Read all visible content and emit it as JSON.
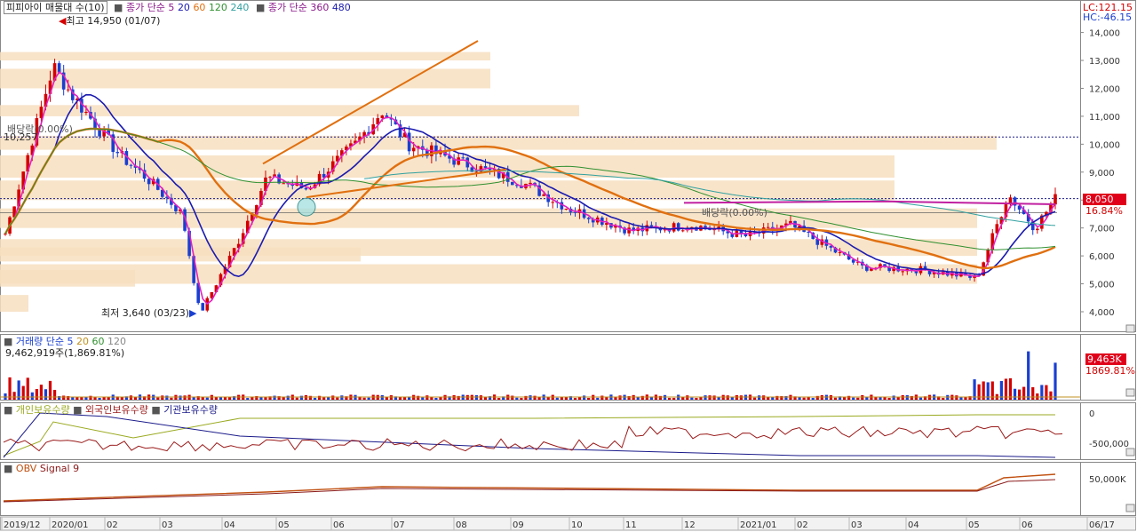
{
  "legend": {
    "stock": "피피아이 매물대 수(10)",
    "sma_main": "종가 단순 5",
    "sma_main_periods": [
      "20",
      "60",
      "120",
      "240"
    ],
    "sma_long": "종가 단순 360",
    "sma_long_periods": [
      "480"
    ],
    "volume": "거래량 단순 5",
    "volume_periods": [
      "20",
      "60",
      "120"
    ],
    "volume_value": "9,462,919주(1,869.81%)",
    "flows": [
      "개인보유수량",
      "외국인보유수량",
      "기관보유수량"
    ],
    "obv": "OBV",
    "obv_signal": "Signal 9"
  },
  "readout": {
    "lc": "LC:121.15",
    "hc": "HC:-46.15"
  },
  "annotations": {
    "high": "최고 14,950 (01/07)",
    "low": "최저 3,640 (03/23)",
    "dividend_left": "배당락(0.00%)",
    "dividend_right": "배당락(0.00%)",
    "level_left": "10,257",
    "current_price": "8,050",
    "current_change": "16.84%",
    "current_volume": "9,463K",
    "current_volume_pct": "1869.81%"
  },
  "colors": {
    "up": "#d40000",
    "down": "#1a3fd0",
    "ma5": "#e020c0",
    "ma20": "#1a1ab0",
    "ma60": "#e07010",
    "ma120": "#309030",
    "ma240": "#30a0a0",
    "profile": "#f7dfc0",
    "accent": "#e0001a"
  },
  "chart_data": {
    "type": "candlestick",
    "x_ticks": [
      "2019/12",
      "2020/01",
      "02",
      "03",
      "04",
      "05",
      "06",
      "07",
      "08",
      "09",
      "10",
      "11",
      "12",
      "2021/01",
      "02",
      "03",
      "04",
      "05",
      "06",
      "06/17"
    ],
    "y_ticks": [
      4000,
      5000,
      6000,
      7000,
      8000,
      9000,
      10000,
      11000,
      12000,
      13000,
      14000
    ],
    "ylim": [
      3300,
      15100
    ],
    "volume_axis_label": "K",
    "flow_ticks": [
      "0",
      "-500,000"
    ],
    "obv_ticks": [
      "50,000K"
    ],
    "high": 14950,
    "low": 3640,
    "last": 8050,
    "close_path": [
      [
        "2019/12",
        6800
      ],
      [
        "2020/01 early",
        12800
      ],
      [
        "2020/01 mid",
        11800
      ],
      [
        "2020/02",
        9600
      ],
      [
        "2020/02 late",
        8800
      ],
      [
        "2020/03",
        7500
      ],
      [
        "2020/03/23",
        3900
      ],
      [
        "2020/04",
        6500
      ],
      [
        "2020/05",
        8800
      ],
      [
        "2020/05 mid",
        8400
      ],
      [
        "2020/06",
        10000
      ],
      [
        "2020/07",
        11200
      ],
      [
        "2020/07 mid",
        10000
      ],
      [
        "2020/08",
        9400
      ],
      [
        "2020/09",
        8600
      ],
      [
        "2020/10",
        7700
      ],
      [
        "2020/11",
        6900
      ],
      [
        "2020/12",
        7100
      ],
      [
        "2021/01",
        6700
      ],
      [
        "2021/02",
        7100
      ],
      [
        "2021/03",
        5600
      ],
      [
        "2021/04",
        5500
      ],
      [
        "2021/05",
        5200
      ],
      [
        "2021/05 late",
        8200
      ],
      [
        "2021/06",
        7000
      ],
      [
        "2021/06/17",
        8050
      ]
    ]
  }
}
